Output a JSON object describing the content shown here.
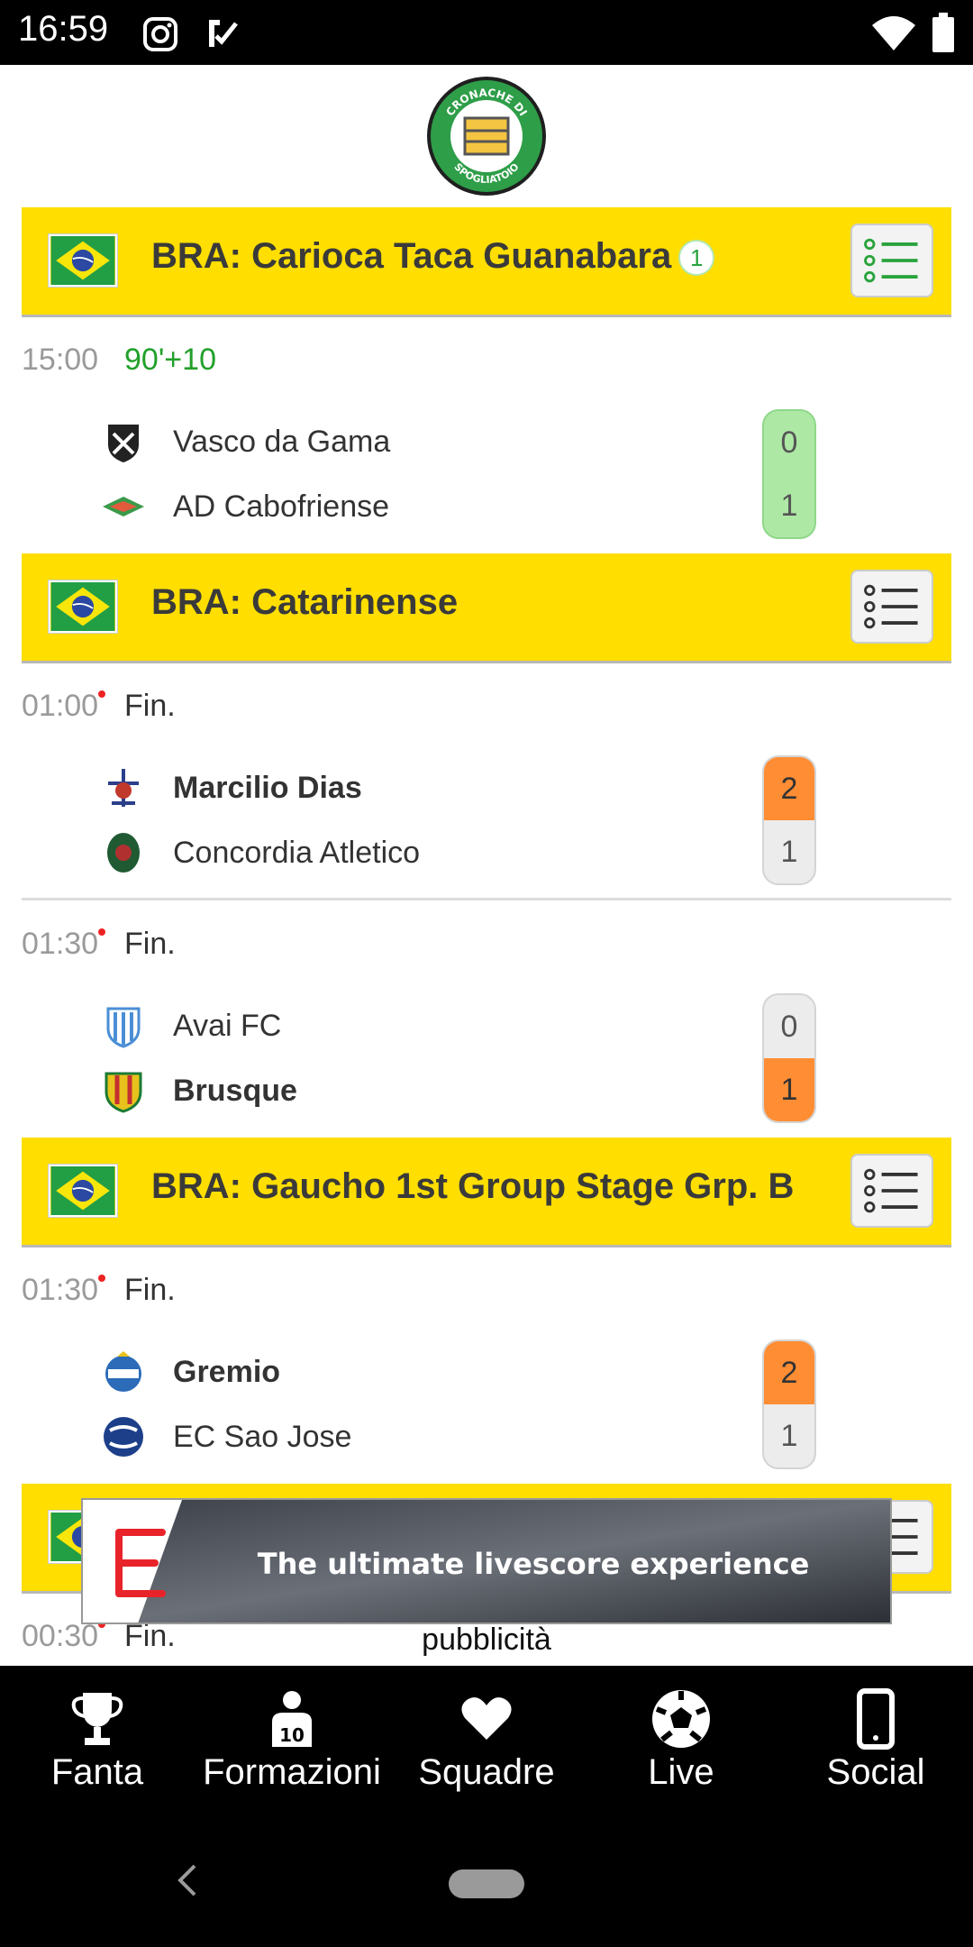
{
  "status_bar": {
    "time": "16:59",
    "icons": [
      "instagram-icon",
      "check-app-icon",
      "wifi-icon",
      "battery-icon"
    ]
  },
  "app": {
    "logo_text_top": "CRONACHE DI",
    "logo_text_bottom": "SPOGLIATOIO"
  },
  "leagues": [
    {
      "name": "BRA:  Carioca Taca Guanabara",
      "live_count": "1",
      "matches": [
        {
          "time": "15:00",
          "status": "90'+10",
          "live": true,
          "home": {
            "name": "Vasco da Gama",
            "score": "0"
          },
          "away": {
            "name": "AD Cabofriense",
            "score": "1"
          }
        }
      ]
    },
    {
      "name": "BRA:  Catarinense",
      "matches": [
        {
          "time": "01:00",
          "status": "Fin.",
          "home": {
            "name": "Marcilio Dias",
            "score": "2"
          },
          "away": {
            "name": "Concordia Atletico",
            "score": "1"
          }
        },
        {
          "time": "01:30",
          "status": "Fin.",
          "home": {
            "name": "Avai FC",
            "score": "0"
          },
          "away": {
            "name": "Brusque",
            "score": "1"
          }
        }
      ]
    },
    {
      "name": "BRA:  Gaucho 1st Group Stage Grp. B",
      "matches": [
        {
          "time": "01:30",
          "status": "Fin.",
          "home": {
            "name": "Gremio",
            "score": "2"
          },
          "away": {
            "name": "EC Sao Jose",
            "score": "1"
          }
        }
      ]
    },
    {
      "name": "",
      "matches": [
        {
          "time": "00:30",
          "status": "Fin."
        }
      ]
    }
  ],
  "ad": {
    "text": "The ultimate livescore experience",
    "label": "pubblicità"
  },
  "bottom_nav": [
    {
      "label": "Fanta",
      "icon": "trophy-icon"
    },
    {
      "label": "Formazioni",
      "icon": "player-jersey-icon"
    },
    {
      "label": "Squadre",
      "icon": "heart-icon"
    },
    {
      "label": "Live",
      "icon": "soccer-ball-icon"
    },
    {
      "label": "Social",
      "icon": "smartphone-icon"
    }
  ],
  "colors": {
    "league_header": "#FFDE00",
    "win_score": "#FF8D34",
    "live_score": "#AEE8A5",
    "live_text": "#22A02A"
  }
}
